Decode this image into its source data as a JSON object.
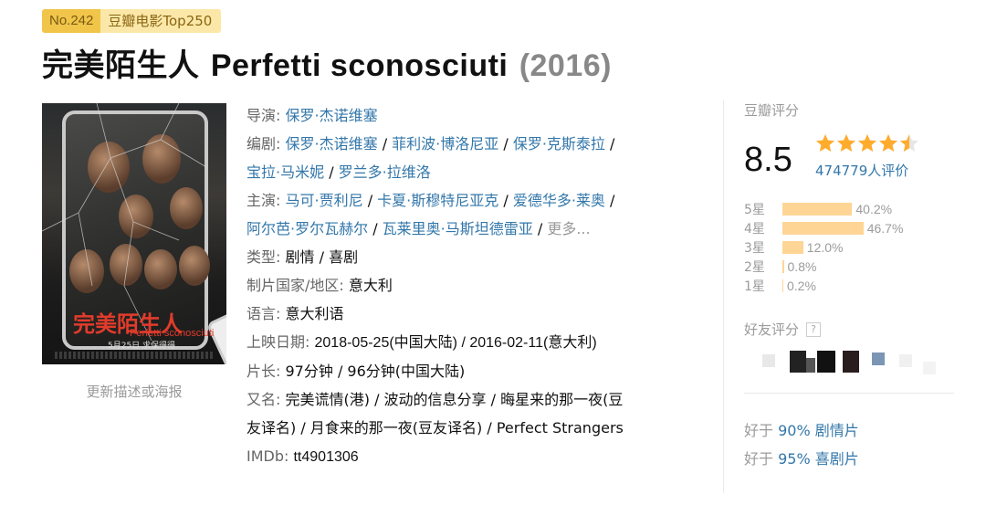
{
  "rank": {
    "number": "No.242",
    "list": "豆瓣电影Top250"
  },
  "title": {
    "cn": "完美陌生人",
    "en": "Perfetti sconosciuti",
    "year": "(2016)"
  },
  "poster": {
    "title": "完美陌生人",
    "subtitle": "Perfetti sconosciuti",
    "date": "5月25日  求保得得"
  },
  "update_link": "更新描述或海报",
  "info": {
    "director_label": "导演:",
    "directors": [
      "保罗·杰诺维塞"
    ],
    "writer_label": "编剧:",
    "writers": [
      "保罗·杰诺维塞",
      "菲利波·博洛尼亚",
      "保罗·克斯泰拉",
      "宝拉·马米妮",
      "罗兰多·拉维洛"
    ],
    "cast_label": "主演:",
    "cast": [
      "马可·贾利尼",
      "卡夏·斯穆特尼亚克",
      "爱德华多·莱奥",
      "阿尔芭·罗尔瓦赫尔",
      "瓦莱里奥·马斯坦德雷亚"
    ],
    "more": "更多...",
    "genre_label": "类型:",
    "genre": "剧情 / 喜剧",
    "country_label": "制片国家/地区:",
    "country": "意大利",
    "language_label": "语言:",
    "language": "意大利语",
    "release_label": "上映日期:",
    "release": "2018-05-25(中国大陆) / 2016-02-11(意大利)",
    "runtime_label": "片长:",
    "runtime": "97分钟 / 96分钟(中国大陆)",
    "aka_label": "又名:",
    "aka_line1": "完美谎情(港) / 波动的信息分享 / 晦星来的那一夜(豆",
    "aka_line2": "友译名) / 月食来的那一夜(豆友译名) / Perfect Strangers",
    "imdb_label": "IMDb:",
    "imdb": "tt4901306"
  },
  "rating": {
    "head": "豆瓣评分",
    "score": "8.5",
    "star_value": 4.5,
    "votes": "474779人评价",
    "star_color": "#ffac2d",
    "bars": [
      {
        "label": "5星",
        "percent": 40.2,
        "text": "40.2%"
      },
      {
        "label": "4星",
        "percent": 46.7,
        "text": "46.7%"
      },
      {
        "label": "3星",
        "percent": 12.0,
        "text": "12.0%"
      },
      {
        "label": "2星",
        "percent": 0.8,
        "text": "0.8%"
      },
      {
        "label": "1星",
        "percent": 0.2,
        "text": "0.2%"
      }
    ],
    "friends_head": "好友评分",
    "help_icon": "?",
    "better_than": [
      {
        "prefix": "好于",
        "link": "90% 剧情片"
      },
      {
        "prefix": "好于",
        "link": "95% 喜剧片"
      }
    ]
  }
}
